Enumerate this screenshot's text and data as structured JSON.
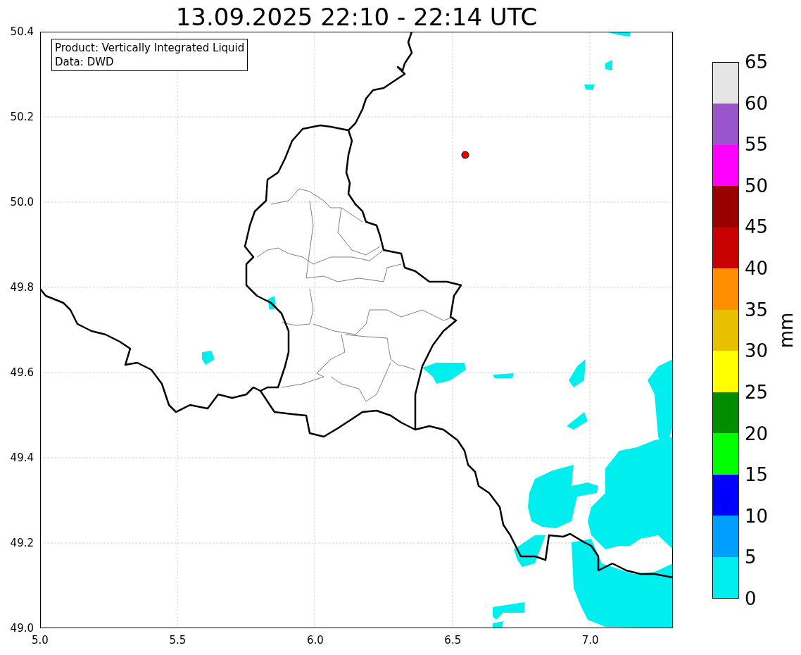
{
  "title": "13.09.2025 22:10 - 22:14 UTC",
  "info_box": [
    "Product: Vertically Integrated Liquid",
    "Data: DWD"
  ],
  "y_ticks": [
    "50.4",
    "50.2",
    "50.0",
    "49.8",
    "49.6",
    "49.4",
    "49.2",
    "49.0"
  ],
  "x_ticks": [
    "5.0",
    "5.5",
    "6.0",
    "6.5",
    "7.0"
  ],
  "colorbar": {
    "label": "mm",
    "segments": [
      {
        "color": "#e5e5e5"
      },
      {
        "color": "#9a55cd"
      },
      {
        "color": "#ff00ff"
      },
      {
        "color": "#9a0000"
      },
      {
        "color": "#c80000"
      },
      {
        "color": "#ff8e00"
      },
      {
        "color": "#e8c000"
      },
      {
        "color": "#ffff00"
      },
      {
        "color": "#008e00"
      },
      {
        "color": "#00ff00"
      },
      {
        "color": "#0000ff"
      },
      {
        "color": "#009eff"
      },
      {
        "color": "#00eeee"
      }
    ],
    "ticks": [
      "65",
      "60",
      "55",
      "50",
      "45",
      "40",
      "35",
      "30",
      "25",
      "20",
      "15",
      "10",
      "5",
      "0"
    ]
  }
}
